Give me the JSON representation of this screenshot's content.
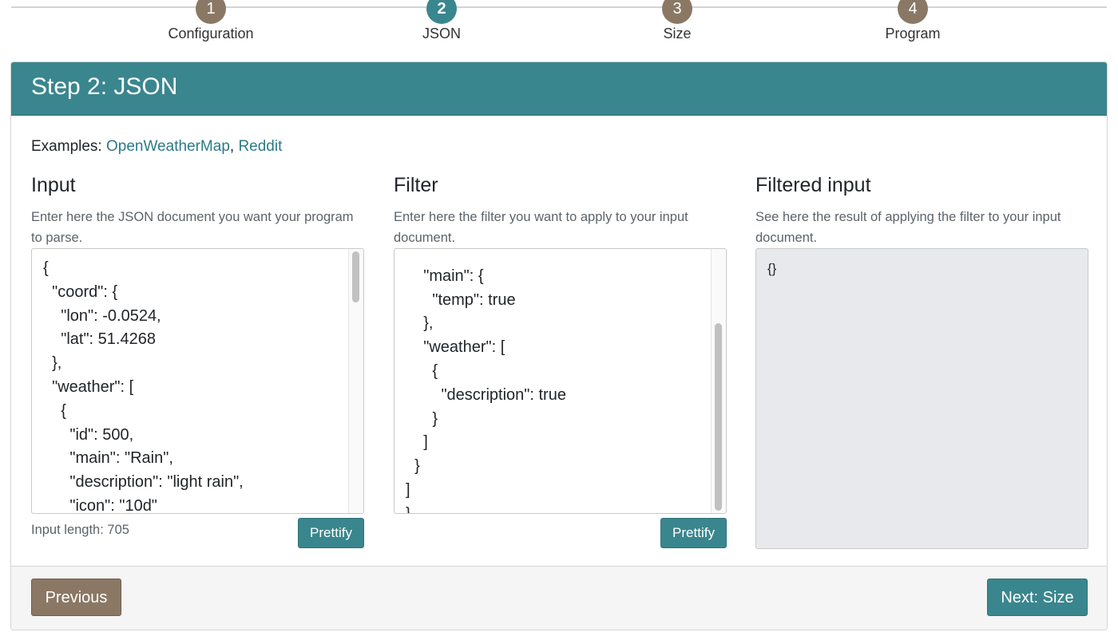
{
  "stepper": {
    "steps": [
      {
        "number": "1",
        "label": "Configuration"
      },
      {
        "number": "2",
        "label": "JSON"
      },
      {
        "number": "3",
        "label": "Size"
      },
      {
        "number": "4",
        "label": "Program"
      }
    ],
    "active_step": 2
  },
  "card": {
    "title": "Step 2: JSON",
    "examples_label": "Examples:",
    "examples": [
      "OpenWeatherMap",
      "Reddit"
    ],
    "examples_separator": ","
  },
  "input": {
    "heading": "Input",
    "description": "Enter here the JSON document you want your program to parse.",
    "content": "{\n  \"coord\": {\n    \"lon\": -0.0524,\n    \"lat\": 51.4268\n  },\n  \"weather\": [\n    {\n      \"id\": 500,\n      \"main\": \"Rain\",\n      \"description\": \"light rain\",\n      \"icon\": \"10d\"",
    "length_text": "Input length: 705",
    "prettify_label": "Prettify"
  },
  "filter": {
    "heading": "Filter",
    "description": "Enter here the filter you want to apply to your input document.",
    "content": "\n    \"main\": {\n      \"temp\": true\n    },\n    \"weather\": [\n      {\n        \"description\": true\n      }\n    ]\n  }\n]\n}",
    "prettify_label": "Prettify"
  },
  "filtered": {
    "heading": "Filtered input",
    "description": "See here the result of applying the filter to your input document.",
    "content": "{}"
  },
  "footer": {
    "previous_label": "Previous",
    "next_label": "Next: Size"
  },
  "colors": {
    "accent": "#3a868e",
    "secondary": "#8a7865",
    "readonly_bg": "#e8e9ec"
  }
}
